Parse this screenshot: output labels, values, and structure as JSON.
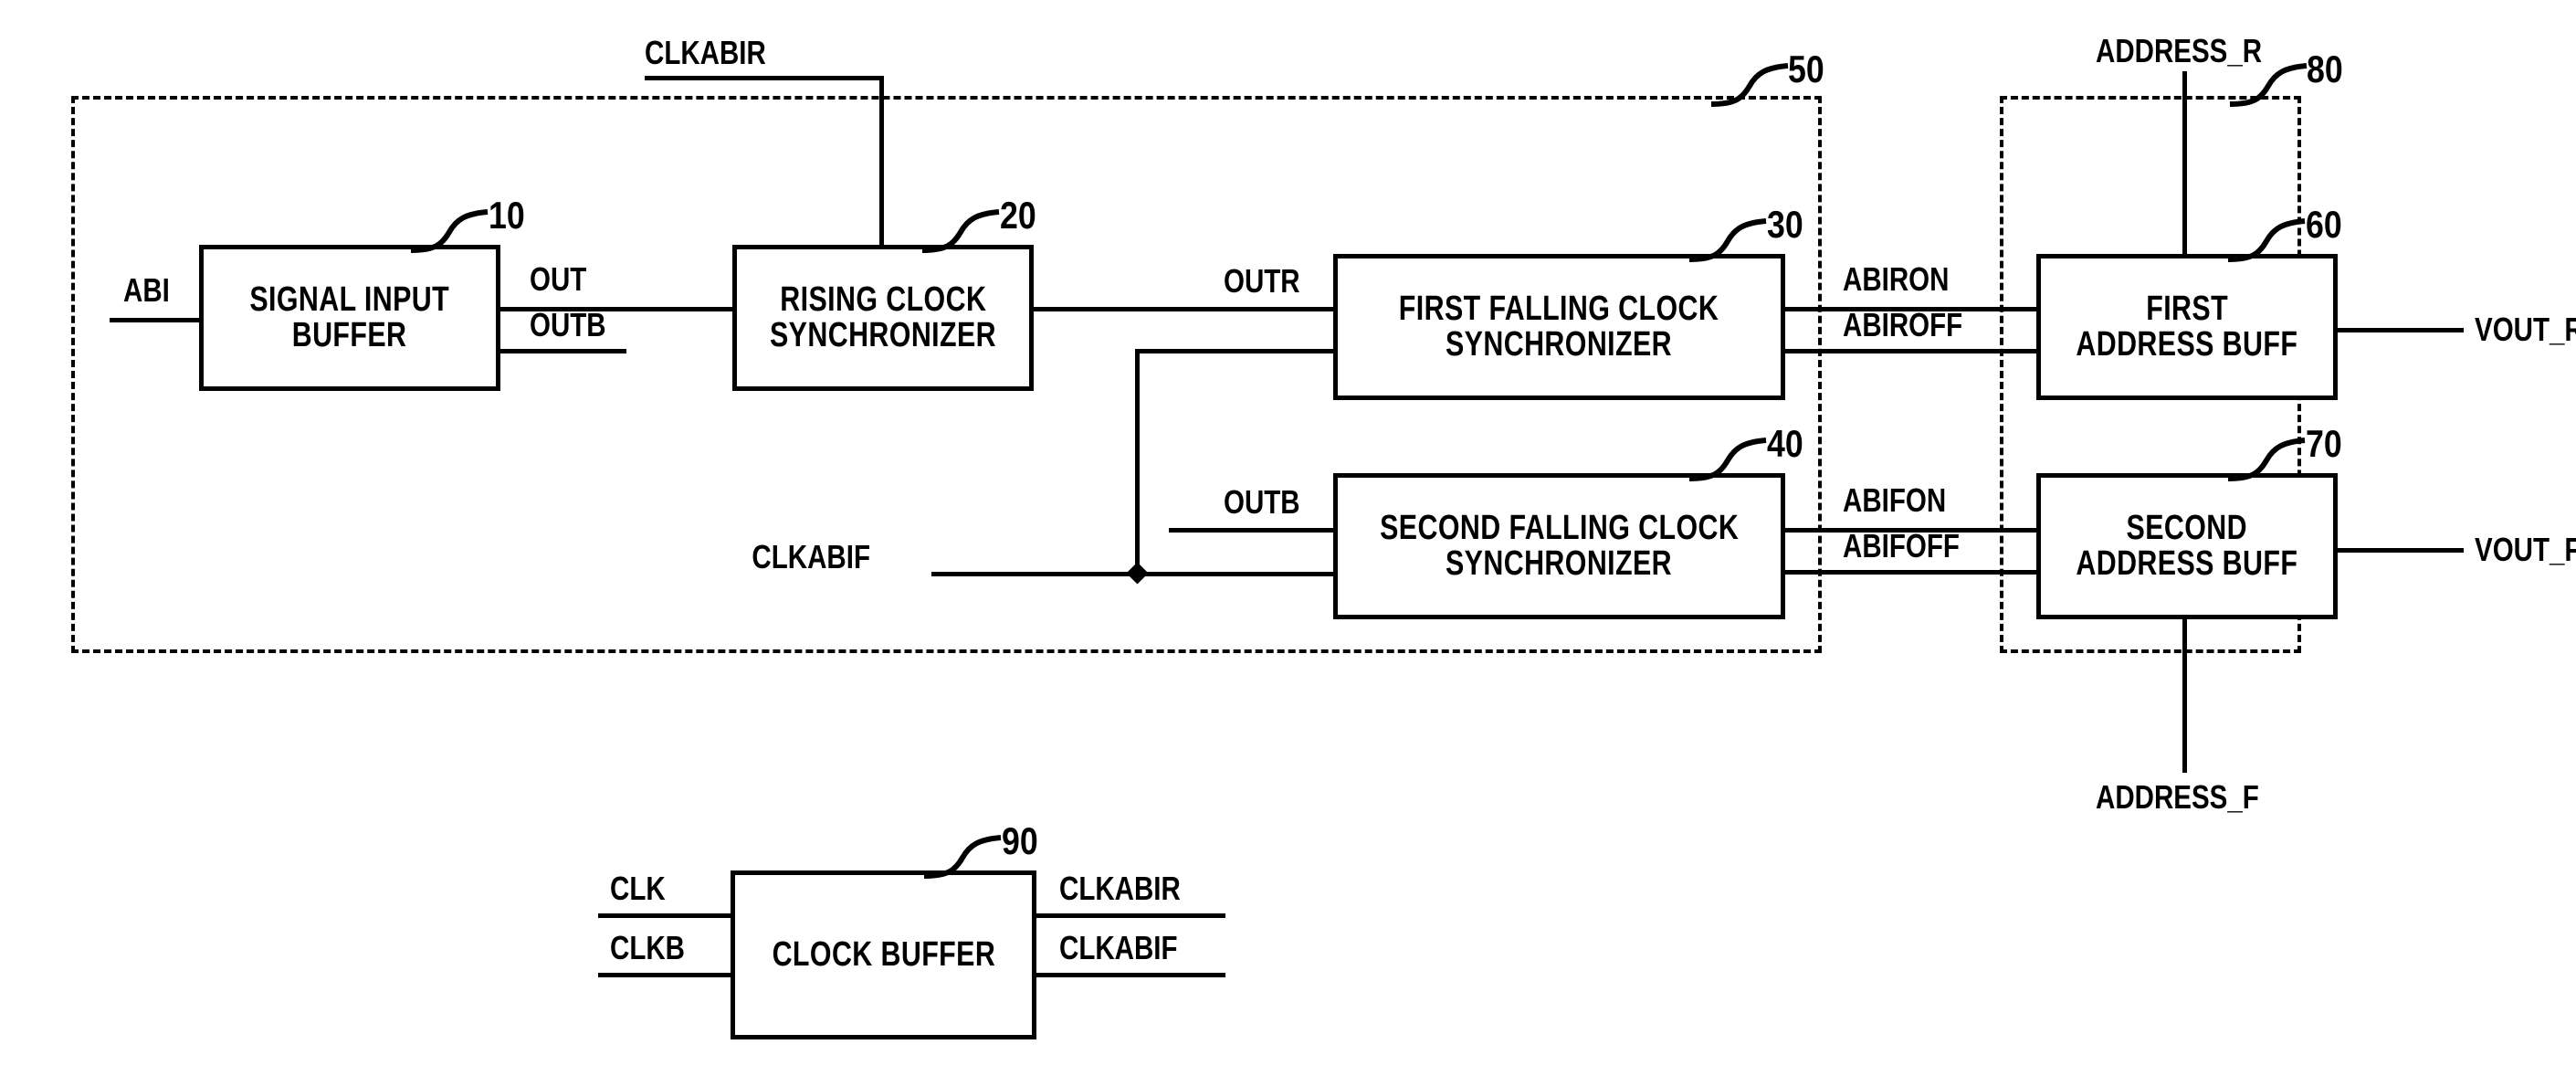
{
  "figure": {
    "kind": "patent-block-diagram",
    "ink_color": "#000000",
    "background_color": "#ffffff"
  },
  "blocks": {
    "signal_input_buffer": {
      "line1": "SIGNAL INPUT",
      "line2": "BUFFER",
      "ref": "10"
    },
    "rising_clock_sync": {
      "line1": "RISING CLOCK",
      "line2": "SYNCHRONIZER",
      "ref": "20"
    },
    "first_falling_sync": {
      "line1": "FIRST FALLING CLOCK",
      "line2": "SYNCHRONIZER",
      "ref": "30"
    },
    "second_falling_sync": {
      "line1": "SECOND FALLING CLOCK",
      "line2": "SYNCHRONIZER",
      "ref": "40"
    },
    "first_address_buff": {
      "line1": "FIRST",
      "line2": "ADDRESS BUFF",
      "ref": "60"
    },
    "second_address_buff": {
      "line1": "SECOND",
      "line2": "ADDRESS BUFF",
      "ref": "70"
    },
    "clock_buffer": {
      "line1": "CLOCK BUFFER",
      "line2": "",
      "ref": "90"
    }
  },
  "groups": {
    "synchronizer_group": {
      "ref": "50"
    },
    "address_buffer_group": {
      "ref": "80"
    }
  },
  "signals": {
    "abi": "ABI",
    "out": "OUT",
    "outb_top": "OUTB",
    "clkabir_top": "CLKABIR",
    "outr": "OUTR",
    "outb_mid": "OUTB",
    "clkabif_mid": "CLKABIF",
    "abiron": "ABIRON",
    "abiroff": "ABIROFF",
    "abifon": "ABIFON",
    "abifoff": "ABIFOFF",
    "address_r": "ADDRESS_R",
    "address_f": "ADDRESS_F",
    "vout_r": "VOUT_R",
    "vout_f": "VOUT_F",
    "clk": "CLK",
    "clkb": "CLKB",
    "clkabir_out": "CLKABIR",
    "clkabif_out": "CLKABIF"
  }
}
